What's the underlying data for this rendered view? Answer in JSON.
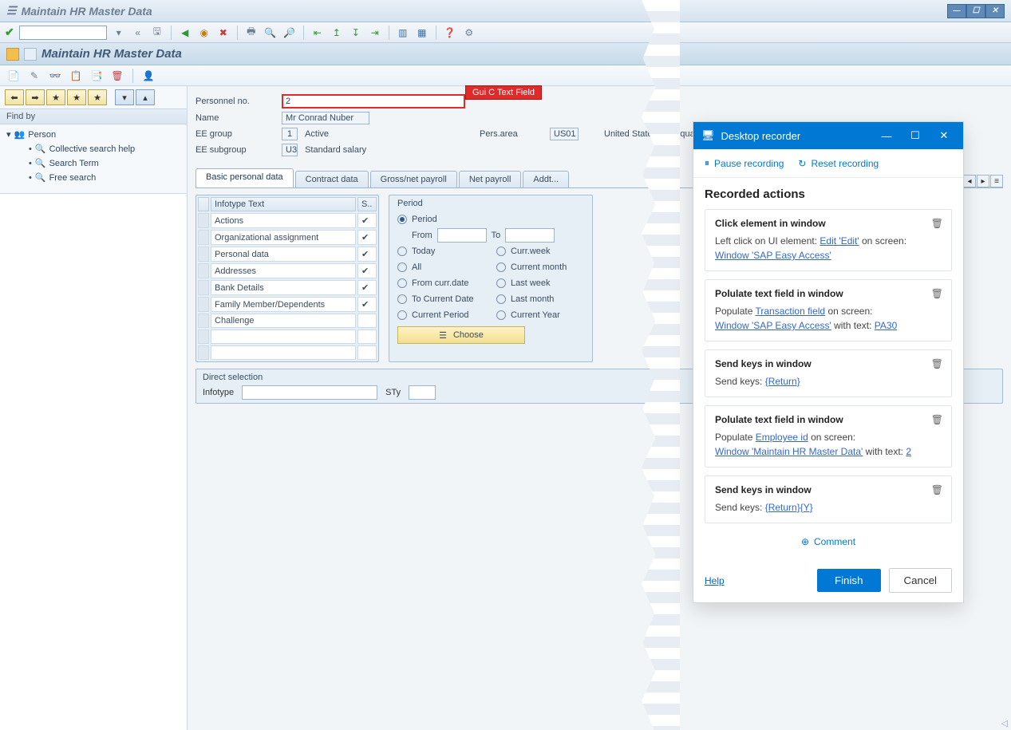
{
  "window": {
    "title": "Maintain HR Master Data"
  },
  "subtitle": "Maintain HR Master Data",
  "redTag": "Gui C Text Field",
  "header": {
    "personnel_no_label": "Personnel no.",
    "personnel_no_value": "2",
    "name_label": "Name",
    "name_value": "Mr Conrad Nuber",
    "ee_group_label": "EE group",
    "ee_group_code": "1",
    "ee_group_text": "Active",
    "pers_area_label": "Pers.area",
    "pers_area_code": "US01",
    "pers_area_text": "United States Headqua..",
    "ee_subgroup_label": "EE subgroup",
    "ee_subgroup_code": "U3",
    "ee_subgroup_text": "Standard salary"
  },
  "findby": {
    "label": "Find by"
  },
  "tree": {
    "root": "Person",
    "children": [
      "Collective search help",
      "Search Term",
      "Free search"
    ]
  },
  "tabs": [
    "Basic personal data",
    "Contract data",
    "Gross/net payroll",
    "Net payroll",
    "Addt..."
  ],
  "infotype": {
    "col_text": "Infotype Text",
    "col_s": "S..",
    "rows": [
      "Actions",
      "Organizational assignment",
      "Personal data",
      "Addresses",
      "Bank Details",
      "Family Member/Dependents",
      "Challenge"
    ]
  },
  "period": {
    "title": "Period",
    "period_label": "Period",
    "from_label": "From",
    "to_label": "To",
    "today": "Today",
    "currweek": "Curr.week",
    "all": "All",
    "currmonth": "Current month",
    "fromcurr": "From curr.date",
    "lastweek": "Last week",
    "tocurr": "To Current Date",
    "lastmonth": "Last month",
    "currperiod": "Current Period",
    "curryear": "Current Year",
    "choose": "Choose"
  },
  "direct": {
    "title": "Direct selection",
    "infotype_label": "Infotype",
    "sty_label": "STy"
  },
  "recorder": {
    "title": "Desktop recorder",
    "pause": "Pause recording",
    "reset": "Reset recording",
    "heading": "Recorded actions",
    "cards": [
      {
        "t": "Click element in window",
        "l1a": "Left click on UI element: ",
        "l1b": "Edit 'Edit'",
        "l1c": " on screen:",
        "l2": "Window 'SAP Easy Access'"
      },
      {
        "t": "Polulate text field in window",
        "l1a": "Populate ",
        "l1b": "Transaction field",
        "l1c": " on screen:",
        "l2": "Window 'SAP Easy Access'",
        "l2b": " with text: ",
        "l2c": "PA30"
      },
      {
        "t": "Send keys in window",
        "l1a": "Send keys: ",
        "l1b": "{Return}"
      },
      {
        "t": "Polulate text field in window",
        "l1a": "Populate ",
        "l1b": "Employee id",
        "l1c": " on screen:",
        "l2": "Window 'Maintain HR Master Data'",
        "l2b": " with text: ",
        "l2c": "2"
      },
      {
        "t": "Send keys in window",
        "l1a": "Send keys: ",
        "l1b": "{Return}{Y}"
      }
    ],
    "comment": "Comment",
    "help": "Help",
    "finish": "Finish",
    "cancel": "Cancel"
  }
}
